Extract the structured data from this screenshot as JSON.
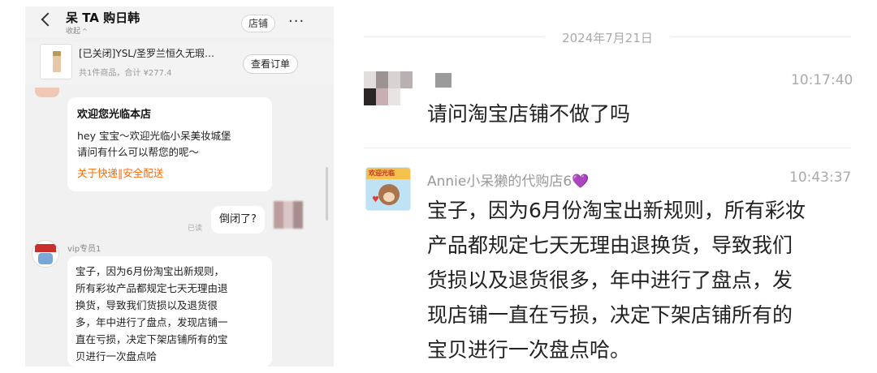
{
  "left": {
    "header": {
      "title": "呆 TA 购日韩",
      "collapse_label": "收起",
      "shop_button": "店铺",
      "more_icon": "···"
    },
    "order": {
      "title": "[已关闭]YSL/圣罗兰恒久无瑕…",
      "summary": "共1件商品，合计 ¥277.4",
      "view_button": "查看订单"
    },
    "welcome": {
      "title": "欢迎您光临本店",
      "line1": "hey 宝宝～欢迎光临小呆美妆城堡",
      "line2": "请问有什么可以帮您的呢～",
      "link": "关于快递‖安全配送"
    },
    "customer_message": {
      "text": "倒闭了?",
      "read_status": "已读"
    },
    "reply": {
      "sender": "vip专员1",
      "lines": [
        "宝子，因为6月份淘宝出新规则，",
        "所有彩妆产品都规定七天无理由退",
        "换货，导致我们货损以及退货很",
        "多，年中进行了盘点，发现店铺一",
        "直在亏损，决定下架店铺所有的宝",
        "贝进行一次盘点哈"
      ]
    }
  },
  "right": {
    "date": "2024年7月21日",
    "message1": {
      "time": "10:17:40",
      "text": "请问淘宝店铺不做了吗"
    },
    "message2": {
      "sender": "Annie小呆獭的代购店6",
      "sender_icon": "💜",
      "avatar_text": "欢迎光临",
      "time": "10:43:37",
      "lines": [
        "宝子，因为6月份淘宝出新规则，所有彩妆",
        "产品都规定七天无理由退换货，导致我们",
        "货损以及退货很多，年中进行了盘点，发",
        "现店铺一直在亏损，决定下架店铺所有的",
        "宝贝进行一次盘点哈。"
      ]
    }
  },
  "colors": {
    "accent_orange": "#ff6a00",
    "heart_pink": "#e65bd1",
    "chat_bg": "#f1f1f1"
  }
}
